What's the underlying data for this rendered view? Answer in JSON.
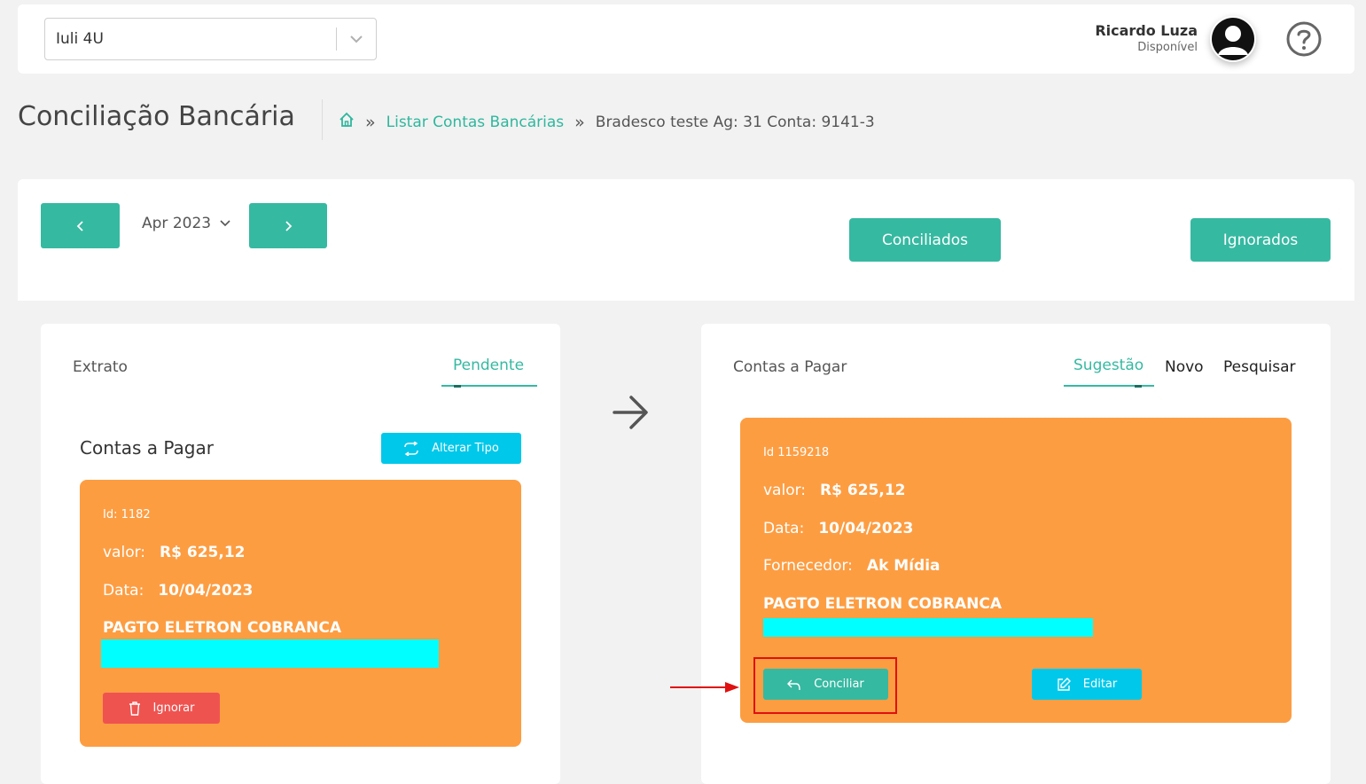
{
  "header": {
    "company": "Iuli 4U",
    "user_name": "Ricardo Luza",
    "user_status": "Disponível"
  },
  "page": {
    "title": "Conciliação Bancária",
    "breadcrumb_link": "Listar Contas Bancárias",
    "breadcrumb_current": "Bradesco teste Ag: 31 Conta: 9141-3"
  },
  "toolbar": {
    "month": "Apr 2023",
    "conciliados": "Conciliados",
    "ignorados": "Ignorados"
  },
  "left": {
    "tab_extrato": "Extrato",
    "tab_pendente": "Pendente",
    "section_title": "Contas a Pagar",
    "alterar_tipo": "Alterar Tipo",
    "item": {
      "id": "Id: 1182",
      "valor_label": "valor:",
      "valor": "R$ 625,12",
      "data_label": "Data:",
      "data": "10/04/2023",
      "description": "PAGTO ELETRON COBRANCA"
    },
    "ignorar": "Ignorar"
  },
  "right": {
    "tab_title": "Contas a Pagar",
    "tab_sugestao": "Sugestão",
    "tab_novo": "Novo",
    "tab_pesquisar": "Pesquisar",
    "item": {
      "id": "Id 1159218",
      "valor_label": "valor:",
      "valor": "R$ 625,12",
      "data_label": "Data:",
      "data": "10/04/2023",
      "fornecedor_label": "Fornecedor:",
      "fornecedor": "Ak Mídia",
      "description": "PAGTO ELETRON COBRANCA"
    },
    "conciliar": "Conciliar",
    "editar": "Editar"
  },
  "colors": {
    "accent": "#36b9a1",
    "orange": "#fd9d42",
    "cyan": "#00c8ea",
    "danger": "#ef5350",
    "highlight": "#00ffff",
    "annotation": "#e01010"
  }
}
